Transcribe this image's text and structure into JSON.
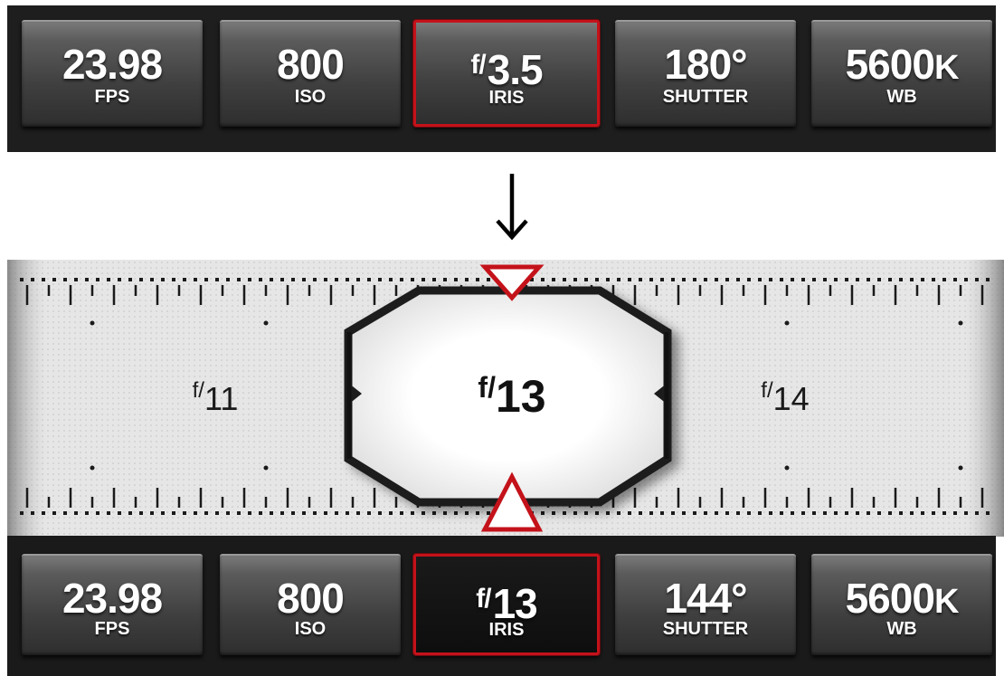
{
  "top_bar": {
    "buttons": [
      {
        "value": "23.98",
        "label": "FPS"
      },
      {
        "value": "800",
        "label": "ISO"
      },
      {
        "prefix": "f/",
        "value": "3.5",
        "label": "IRIS",
        "selected": true
      },
      {
        "value": "180°",
        "label": "SHUTTER"
      },
      {
        "value": "5600",
        "unit": "K",
        "label": "WB"
      }
    ]
  },
  "transition_icon": "down-arrow-icon",
  "iris_dial": {
    "prefix": "f/",
    "selected_value": "13",
    "left_value": "11",
    "right_value": "14",
    "pointer_color": "#c4121a"
  },
  "bottom_bar": {
    "buttons": [
      {
        "value": "23.98",
        "label": "FPS"
      },
      {
        "value": "800",
        "label": "ISO"
      },
      {
        "prefix": "f/",
        "value": "13",
        "label": "IRIS",
        "selected": true
      },
      {
        "value": "144°",
        "label": "SHUTTER"
      },
      {
        "value": "5600",
        "unit": "K",
        "label": "WB"
      }
    ]
  },
  "colors": {
    "bar_background": "#1e1e1e",
    "selection_accent": "#c4121a",
    "dial_background": "#e6e6e6"
  }
}
